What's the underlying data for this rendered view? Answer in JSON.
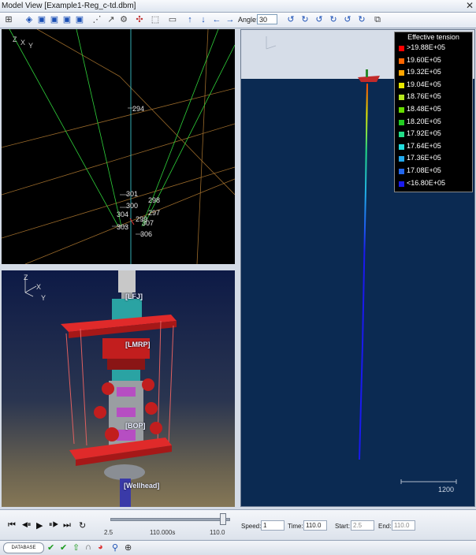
{
  "window": {
    "title": "Model View [Example1-Reg_c-td.dbm]",
    "close": "✕"
  },
  "toolbar": {
    "angle_label": "Angle:",
    "angle_value": "30"
  },
  "wireframe_view": {
    "axes": {
      "z": "Z",
      "y": "Y",
      "x": "X"
    },
    "nodes": [
      "294",
      "301",
      "300",
      "298",
      "297",
      "304",
      "299",
      "307",
      "303",
      "306"
    ]
  },
  "render_view": {
    "axes": {
      "z": "Z",
      "x": "X",
      "y": "Y"
    },
    "labels": {
      "lfj": "[LFJ]",
      "lmrp": "[LMRP]",
      "bop": "[BOP]",
      "wellhead": "[Wellhead]"
    }
  },
  "riser_view": {
    "scale_label": "1200",
    "legend": {
      "title": "Effective tension",
      "items": [
        {
          "label": ">19.88E+05",
          "color": "#ff0000"
        },
        {
          "label": "19.60E+05",
          "color": "#ff6600"
        },
        {
          "label": "19.32E+05",
          "color": "#ffa500"
        },
        {
          "label": "19.04E+05",
          "color": "#e6e600"
        },
        {
          "label": "18.76E+05",
          "color": "#b5e61d"
        },
        {
          "label": "18.48E+05",
          "color": "#66dd00"
        },
        {
          "label": "18.20E+05",
          "color": "#22cc22"
        },
        {
          "label": "17.92E+05",
          "color": "#22dd88"
        },
        {
          "label": "17.64E+05",
          "color": "#22dddd"
        },
        {
          "label": "17.36E+05",
          "color": "#22aaee"
        },
        {
          "label": "17.08E+05",
          "color": "#2266ee"
        },
        {
          "label": "<16.80E+05",
          "color": "#1a1aee"
        }
      ]
    }
  },
  "playback": {
    "buttons": [
      "⏮",
      "◀⏸",
      "▶",
      "⏸▶",
      "⏭",
      "↻"
    ],
    "slider": {
      "min": "2.5",
      "current": "110.000s",
      "max": "110.0",
      "position": 0.99
    },
    "speed_label": "Speed:",
    "speed_value": "1",
    "time_label": "Time:",
    "time_value": "110.0",
    "start_label": "Start:",
    "start_value": "2.5",
    "end_label": "End:",
    "end_value": "110.0"
  },
  "statusbar": {
    "database_label": "DATABASE"
  }
}
